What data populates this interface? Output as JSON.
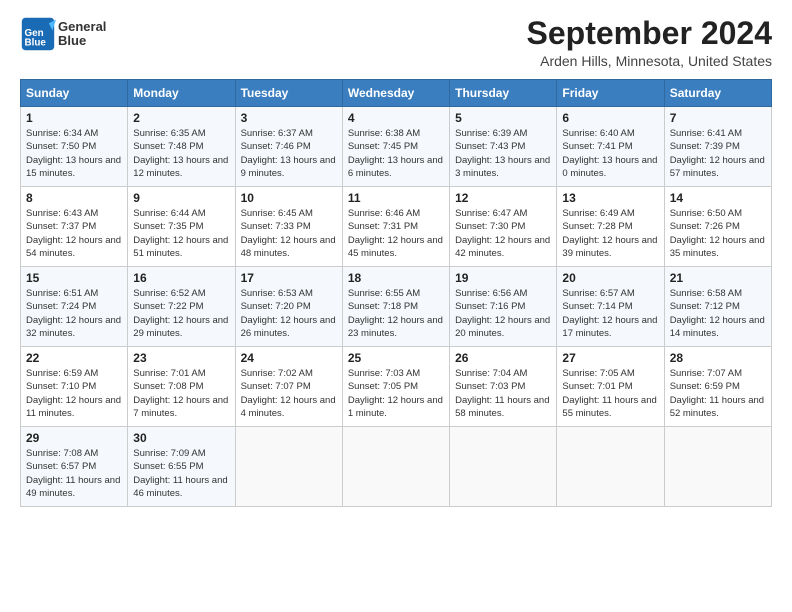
{
  "header": {
    "logo_line1": "General",
    "logo_line2": "Blue",
    "month": "September 2024",
    "location": "Arden Hills, Minnesota, United States"
  },
  "days_of_week": [
    "Sunday",
    "Monday",
    "Tuesday",
    "Wednesday",
    "Thursday",
    "Friday",
    "Saturday"
  ],
  "weeks": [
    [
      {
        "day": "1",
        "sunrise": "6:34 AM",
        "sunset": "7:50 PM",
        "daylight": "13 hours and 15 minutes."
      },
      {
        "day": "2",
        "sunrise": "6:35 AM",
        "sunset": "7:48 PM",
        "daylight": "13 hours and 12 minutes."
      },
      {
        "day": "3",
        "sunrise": "6:37 AM",
        "sunset": "7:46 PM",
        "daylight": "13 hours and 9 minutes."
      },
      {
        "day": "4",
        "sunrise": "6:38 AM",
        "sunset": "7:45 PM",
        "daylight": "13 hours and 6 minutes."
      },
      {
        "day": "5",
        "sunrise": "6:39 AM",
        "sunset": "7:43 PM",
        "daylight": "13 hours and 3 minutes."
      },
      {
        "day": "6",
        "sunrise": "6:40 AM",
        "sunset": "7:41 PM",
        "daylight": "13 hours and 0 minutes."
      },
      {
        "day": "7",
        "sunrise": "6:41 AM",
        "sunset": "7:39 PM",
        "daylight": "12 hours and 57 minutes."
      }
    ],
    [
      {
        "day": "8",
        "sunrise": "6:43 AM",
        "sunset": "7:37 PM",
        "daylight": "12 hours and 54 minutes."
      },
      {
        "day": "9",
        "sunrise": "6:44 AM",
        "sunset": "7:35 PM",
        "daylight": "12 hours and 51 minutes."
      },
      {
        "day": "10",
        "sunrise": "6:45 AM",
        "sunset": "7:33 PM",
        "daylight": "12 hours and 48 minutes."
      },
      {
        "day": "11",
        "sunrise": "6:46 AM",
        "sunset": "7:31 PM",
        "daylight": "12 hours and 45 minutes."
      },
      {
        "day": "12",
        "sunrise": "6:47 AM",
        "sunset": "7:30 PM",
        "daylight": "12 hours and 42 minutes."
      },
      {
        "day": "13",
        "sunrise": "6:49 AM",
        "sunset": "7:28 PM",
        "daylight": "12 hours and 39 minutes."
      },
      {
        "day": "14",
        "sunrise": "6:50 AM",
        "sunset": "7:26 PM",
        "daylight": "12 hours and 35 minutes."
      }
    ],
    [
      {
        "day": "15",
        "sunrise": "6:51 AM",
        "sunset": "7:24 PM",
        "daylight": "12 hours and 32 minutes."
      },
      {
        "day": "16",
        "sunrise": "6:52 AM",
        "sunset": "7:22 PM",
        "daylight": "12 hours and 29 minutes."
      },
      {
        "day": "17",
        "sunrise": "6:53 AM",
        "sunset": "7:20 PM",
        "daylight": "12 hours and 26 minutes."
      },
      {
        "day": "18",
        "sunrise": "6:55 AM",
        "sunset": "7:18 PM",
        "daylight": "12 hours and 23 minutes."
      },
      {
        "day": "19",
        "sunrise": "6:56 AM",
        "sunset": "7:16 PM",
        "daylight": "12 hours and 20 minutes."
      },
      {
        "day": "20",
        "sunrise": "6:57 AM",
        "sunset": "7:14 PM",
        "daylight": "12 hours and 17 minutes."
      },
      {
        "day": "21",
        "sunrise": "6:58 AM",
        "sunset": "7:12 PM",
        "daylight": "12 hours and 14 minutes."
      }
    ],
    [
      {
        "day": "22",
        "sunrise": "6:59 AM",
        "sunset": "7:10 PM",
        "daylight": "12 hours and 11 minutes."
      },
      {
        "day": "23",
        "sunrise": "7:01 AM",
        "sunset": "7:08 PM",
        "daylight": "12 hours and 7 minutes."
      },
      {
        "day": "24",
        "sunrise": "7:02 AM",
        "sunset": "7:07 PM",
        "daylight": "12 hours and 4 minutes."
      },
      {
        "day": "25",
        "sunrise": "7:03 AM",
        "sunset": "7:05 PM",
        "daylight": "12 hours and 1 minute."
      },
      {
        "day": "26",
        "sunrise": "7:04 AM",
        "sunset": "7:03 PM",
        "daylight": "11 hours and 58 minutes."
      },
      {
        "day": "27",
        "sunrise": "7:05 AM",
        "sunset": "7:01 PM",
        "daylight": "11 hours and 55 minutes."
      },
      {
        "day": "28",
        "sunrise": "7:07 AM",
        "sunset": "6:59 PM",
        "daylight": "11 hours and 52 minutes."
      }
    ],
    [
      {
        "day": "29",
        "sunrise": "7:08 AM",
        "sunset": "6:57 PM",
        "daylight": "11 hours and 49 minutes."
      },
      {
        "day": "30",
        "sunrise": "7:09 AM",
        "sunset": "6:55 PM",
        "daylight": "11 hours and 46 minutes."
      },
      null,
      null,
      null,
      null,
      null
    ]
  ]
}
